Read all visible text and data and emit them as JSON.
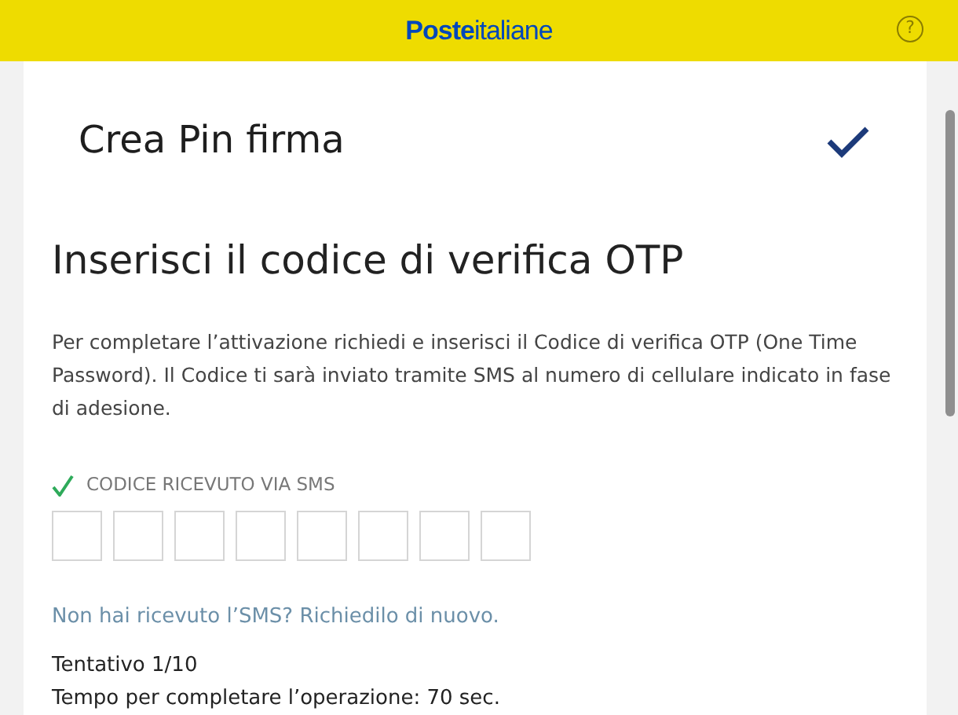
{
  "header": {
    "logo": "**Poste**italiane",
    "help_icon": "?"
  },
  "step": {
    "title": "Crea Pin firma",
    "completed": true
  },
  "heading": "Inserisci il codice di verifica OTP",
  "description": "Per completare l’attivazione richiedi e inserisci il Codice di verifica OTP (One Time Password). Il Codice ti sarà inviato tramite SMS al numero di cellulare indicato in fase di adesione.",
  "otp": {
    "label": "CODICE RICEVUTO VIA SMS",
    "received": true,
    "boxes": [
      {
        "filled": false
      },
      {
        "filled": false
      },
      {
        "filled": false
      },
      {
        "filled": false
      },
      {
        "filled": false
      },
      {
        "filled": false
      },
      {
        "filled": false
      },
      {
        "filled": false
      }
    ]
  },
  "resend_link": "Non hai ricevuto l’SMS? Richiedilo di nuovo.",
  "attempt": "Tentativo 1/10",
  "time_left": "Tempo per completare l’operazione: 70 sec."
}
